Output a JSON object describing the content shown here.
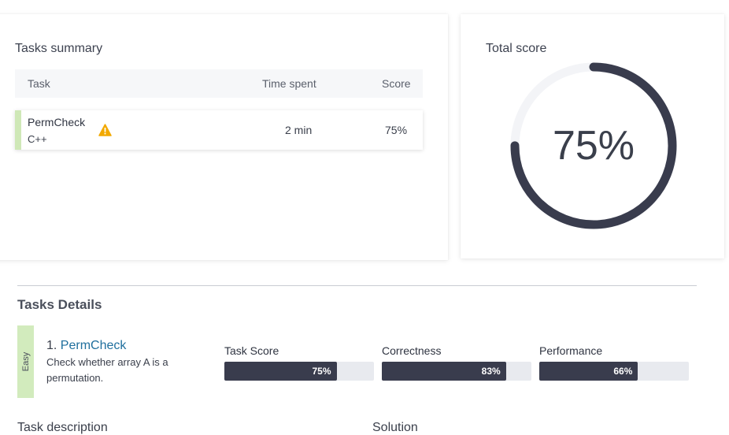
{
  "summary": {
    "title": "Tasks summary",
    "columns": {
      "task": "Task",
      "time": "Time spent",
      "score": "Score"
    },
    "rows": [
      {
        "name": "PermCheck",
        "language": "C++",
        "time": "2 min",
        "score": "75%",
        "warning_icon": "warning-triangle-icon"
      }
    ]
  },
  "total": {
    "title": "Total score",
    "value_text": "75%",
    "value": 0.75
  },
  "details": {
    "title": "Tasks Details",
    "task": {
      "difficulty": "Easy",
      "number": "1.",
      "name": "PermCheck",
      "description": "Check whether array A is a permutation."
    },
    "metrics": [
      {
        "label": "Task Score",
        "value_text": "75%",
        "value": 0.75
      },
      {
        "label": "Correctness",
        "value_text": "83%",
        "value": 0.83
      },
      {
        "label": "Performance",
        "value_text": "66%",
        "value": 0.66
      }
    ],
    "bottom_labels": {
      "description": "Task description",
      "solution": "Solution"
    }
  },
  "colors": {
    "accent_green": "#cfe8b7",
    "ring_dark": "#393c4d",
    "ring_track": "#f3f4f7",
    "link_blue": "#1f6f9d",
    "warning": "#f2a900"
  }
}
